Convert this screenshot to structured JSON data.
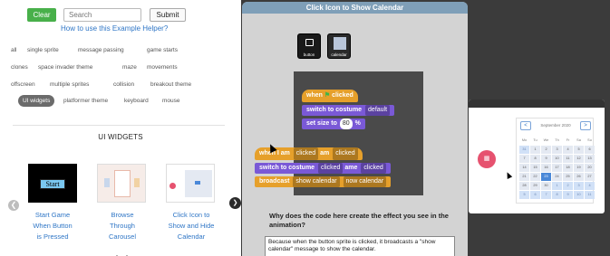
{
  "toolbar": {
    "clear_label": "Clear",
    "search_placeholder": "Search",
    "submit_label": "Submit",
    "helper_link": "How to use this Example Helper?"
  },
  "tags": [
    {
      "label": "all"
    },
    {
      "label": "single sprite"
    },
    {
      "label": "message passing"
    },
    {
      "label": "game starts"
    },
    {
      "label": "clones"
    },
    {
      "label": "space invader theme"
    },
    {
      "label": "maze"
    },
    {
      "label": "movements"
    },
    {
      "label": "offscreen"
    },
    {
      "label": "multiple sprites"
    },
    {
      "label": "collision"
    },
    {
      "label": "breakout theme"
    },
    {
      "label": "UI widgets",
      "active": true
    },
    {
      "label": "platformer theme"
    },
    {
      "label": "keyboard"
    },
    {
      "label": "mouse"
    }
  ],
  "section_title": "UI WIDGETS",
  "carousel": {
    "items": [
      {
        "thumb_text": "Start",
        "caption_lines": [
          "Start Game",
          "When Button",
          "is Pressed"
        ]
      },
      {
        "thumb_text": "",
        "caption_lines": [
          "Browse",
          "Through",
          "Carousel"
        ]
      },
      {
        "thumb_text": "",
        "caption_lines": [
          "Click Icon to",
          "Show and Hide",
          "Calendar"
        ]
      }
    ],
    "prev_icon": "chevron-left-icon",
    "next_icon": "chevron-right-icon"
  },
  "example": {
    "title": "Click Icon to Show Calendar",
    "sprites": [
      {
        "label": "button"
      },
      {
        "label": "calendar"
      }
    ],
    "blocks": {
      "when_clicked": "when",
      "clicked": "clicked",
      "switch_costume": "switch to costume",
      "costume_default": "default",
      "set_size": "set size to",
      "size_value": "80",
      "percent": "%",
      "when_i_am": "when I am",
      "clicked_drop": "clicked",
      "am_label": "am",
      "clicked_drop2": "clicked",
      "switch_costume2": "switch to costume",
      "clicked_drop3": "clicked",
      "name_partial": "ame",
      "clicked_drop4": "clicked",
      "broadcast": "broadcast",
      "show_calendar": "show calendar",
      "now_calendar": "now calendar"
    },
    "question": "Why does the code here create the effect you see in the animation?",
    "answer": "Because when the button sprite is clicked, it broadcasts a \"show calendar\" message to show the calendar."
  },
  "preview": {
    "month": "September 2020",
    "day_heads": [
      "Mo",
      "Tu",
      "We",
      "Th",
      "Fr",
      "Sa",
      "Su"
    ],
    "days": [
      "31",
      "1",
      "2",
      "3",
      "4",
      "5",
      "6",
      "7",
      "8",
      "9",
      "10",
      "11",
      "12",
      "13",
      "14",
      "15",
      "16",
      "17",
      "18",
      "19",
      "20",
      "21",
      "22",
      "23",
      "24",
      "25",
      "26",
      "27",
      "28",
      "29",
      "30",
      "1",
      "2",
      "3",
      "4",
      "5",
      "6",
      "7",
      "8",
      "9",
      "10",
      "11"
    ],
    "today_index": 23,
    "other_month_indices": [
      0,
      31,
      32,
      33,
      34,
      35,
      36,
      37,
      38,
      39,
      40,
      41
    ],
    "prev_label": "<",
    "next_label": ">"
  }
}
